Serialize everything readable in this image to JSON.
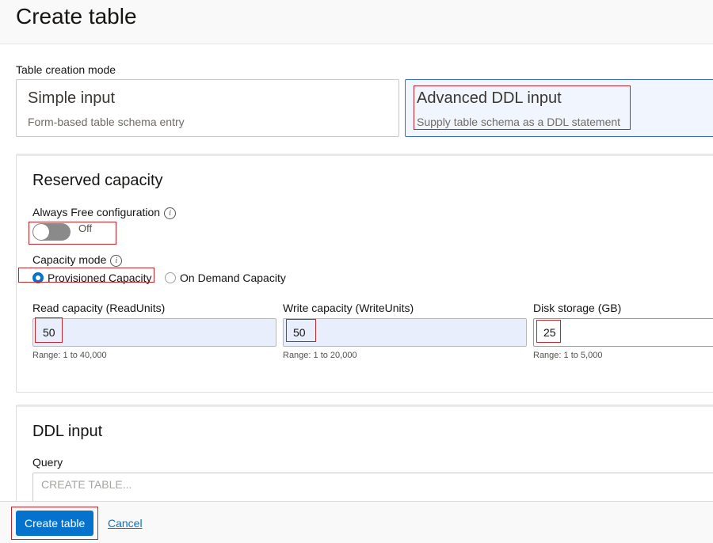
{
  "page": {
    "title": "Create table"
  },
  "creation_mode": {
    "label": "Table creation mode",
    "options": [
      {
        "title": "Simple input",
        "description": "Form-based table schema entry",
        "selected": false
      },
      {
        "title": "Advanced DDL input",
        "description": "Supply table schema as a DDL statement",
        "selected": true
      }
    ]
  },
  "reserved_capacity": {
    "title": "Reserved capacity",
    "always_free": {
      "label": "Always Free configuration",
      "state": "Off",
      "info_icon": "i"
    },
    "capacity_mode": {
      "label": "Capacity mode",
      "info_icon": "i",
      "options": [
        {
          "label": "Provisioned Capacity",
          "selected": true
        },
        {
          "label": "On Demand Capacity",
          "selected": false
        }
      ]
    },
    "fields": [
      {
        "label": "Read capacity (ReadUnits)",
        "value": "50",
        "range": "Range: 1 to 40,000"
      },
      {
        "label": "Write capacity (WriteUnits)",
        "value": "50",
        "range": "Range: 1 to 20,000"
      },
      {
        "label": "Disk storage (GB)",
        "value": "25",
        "range": "Range: 1 to 5,000"
      }
    ]
  },
  "ddl_input": {
    "title": "DDL input",
    "query_label": "Query",
    "query_placeholder": "CREATE TABLE..."
  },
  "footer": {
    "create_label": "Create table",
    "cancel_label": "Cancel"
  },
  "colors": {
    "accent": "#0572ce",
    "highlight_box": "#c0262d",
    "selected_card_bg": "#f1f5fd",
    "input_filled_bg": "#e8eefb"
  }
}
